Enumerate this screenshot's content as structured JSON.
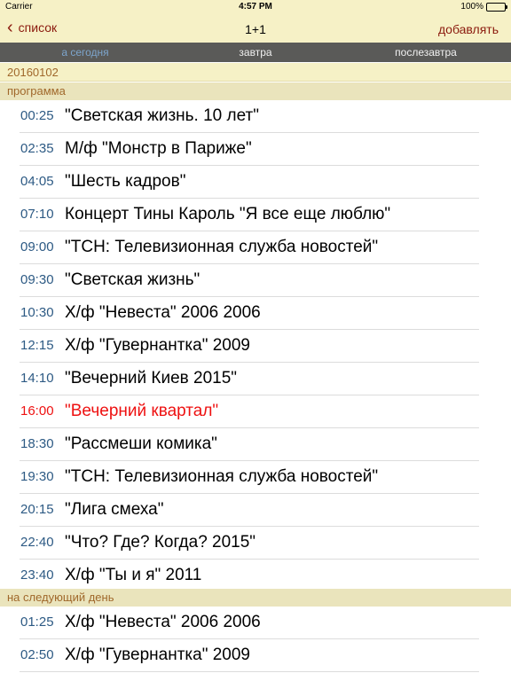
{
  "status_bar": {
    "carrier": "Carrier",
    "time": "4:57 PM",
    "battery": "100%"
  },
  "nav": {
    "back_label": "список",
    "title": "1+1",
    "add_label": "добавлять"
  },
  "tabs": [
    {
      "label": "а сегодня",
      "active": true
    },
    {
      "label": "завтра",
      "active": false
    },
    {
      "label": "послезавтра",
      "active": false
    }
  ],
  "date": "20160102",
  "sections": {
    "program": {
      "header": "программа",
      "items": [
        {
          "time": "00:25",
          "title": "\"Светская жизнь. 10 лет\""
        },
        {
          "time": "02:35",
          "title": "М/ф \"Монстр в Париже\""
        },
        {
          "time": "04:05",
          "title": "\"Шесть кадров\""
        },
        {
          "time": "07:10",
          "title": "Концерт Тины Кароль \"Я все еще люблю\""
        },
        {
          "time": "09:00",
          "title": "\"ТСН: Телевизионная служба новостей\""
        },
        {
          "time": "09:30",
          "title": "\"Светская жизнь\""
        },
        {
          "time": "10:30",
          "title": "Х/ф \"Невеста\" 2006 2006"
        },
        {
          "time": "12:15",
          "title": "Х/ф \"Гувернантка\" 2009"
        },
        {
          "time": "14:10",
          "title": "\"Вечерний Киев 2015\""
        },
        {
          "time": "16:00",
          "title": "\"Вечерний квартал\"",
          "current": true
        },
        {
          "time": "18:30",
          "title": "\"Рассмеши комика\""
        },
        {
          "time": "19:30",
          "title": "\"ТСН: Телевизионная служба новостей\""
        },
        {
          "time": "20:15",
          "title": "\"Лига смеха\""
        },
        {
          "time": "22:40",
          "title": "\"Что? Где? Когда? 2015\""
        },
        {
          "time": "23:40",
          "title": "Х/ф \"Ты и я\" 2011"
        }
      ]
    },
    "next_day": {
      "header": "на следующий день",
      "items": [
        {
          "time": "01:25",
          "title": "Х/ф \"Невеста\" 2006 2006"
        },
        {
          "time": "02:50",
          "title": "Х/ф \"Гувернантка\" 2009"
        }
      ]
    }
  },
  "colors": {
    "accent": "#8b1a0e",
    "time": "#2d5a84",
    "current": "#ee1111",
    "bar_background": "#f6f1c6",
    "tab_bar": "#5a5a58"
  }
}
